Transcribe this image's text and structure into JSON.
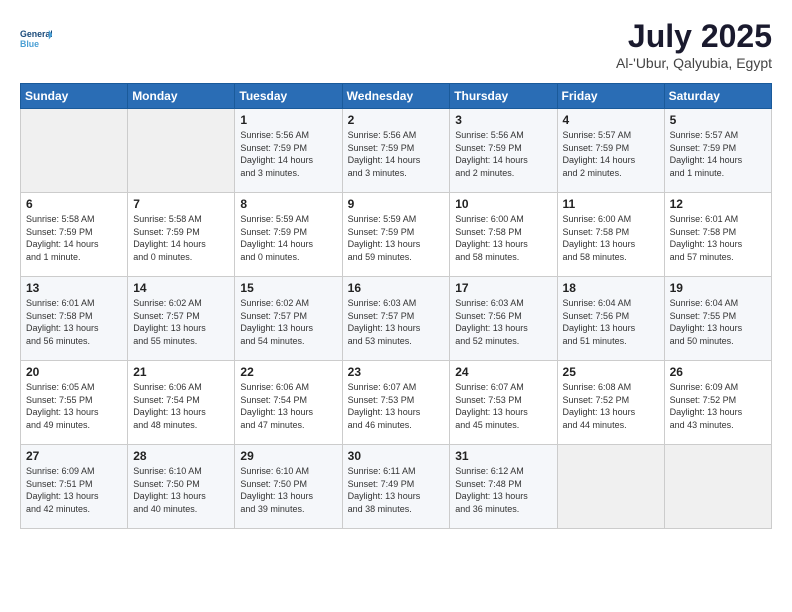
{
  "logo": {
    "line1": "General",
    "line2": "Blue"
  },
  "title": "July 2025",
  "location": "Al-'Ubur, Qalyubia, Egypt",
  "weekdays": [
    "Sunday",
    "Monday",
    "Tuesday",
    "Wednesday",
    "Thursday",
    "Friday",
    "Saturday"
  ],
  "weeks": [
    [
      {
        "day": "",
        "info": ""
      },
      {
        "day": "",
        "info": ""
      },
      {
        "day": "1",
        "info": "Sunrise: 5:56 AM\nSunset: 7:59 PM\nDaylight: 14 hours\nand 3 minutes."
      },
      {
        "day": "2",
        "info": "Sunrise: 5:56 AM\nSunset: 7:59 PM\nDaylight: 14 hours\nand 3 minutes."
      },
      {
        "day": "3",
        "info": "Sunrise: 5:56 AM\nSunset: 7:59 PM\nDaylight: 14 hours\nand 2 minutes."
      },
      {
        "day": "4",
        "info": "Sunrise: 5:57 AM\nSunset: 7:59 PM\nDaylight: 14 hours\nand 2 minutes."
      },
      {
        "day": "5",
        "info": "Sunrise: 5:57 AM\nSunset: 7:59 PM\nDaylight: 14 hours\nand 1 minute."
      }
    ],
    [
      {
        "day": "6",
        "info": "Sunrise: 5:58 AM\nSunset: 7:59 PM\nDaylight: 14 hours\nand 1 minute."
      },
      {
        "day": "7",
        "info": "Sunrise: 5:58 AM\nSunset: 7:59 PM\nDaylight: 14 hours\nand 0 minutes."
      },
      {
        "day": "8",
        "info": "Sunrise: 5:59 AM\nSunset: 7:59 PM\nDaylight: 14 hours\nand 0 minutes."
      },
      {
        "day": "9",
        "info": "Sunrise: 5:59 AM\nSunset: 7:59 PM\nDaylight: 13 hours\nand 59 minutes."
      },
      {
        "day": "10",
        "info": "Sunrise: 6:00 AM\nSunset: 7:58 PM\nDaylight: 13 hours\nand 58 minutes."
      },
      {
        "day": "11",
        "info": "Sunrise: 6:00 AM\nSunset: 7:58 PM\nDaylight: 13 hours\nand 58 minutes."
      },
      {
        "day": "12",
        "info": "Sunrise: 6:01 AM\nSunset: 7:58 PM\nDaylight: 13 hours\nand 57 minutes."
      }
    ],
    [
      {
        "day": "13",
        "info": "Sunrise: 6:01 AM\nSunset: 7:58 PM\nDaylight: 13 hours\nand 56 minutes."
      },
      {
        "day": "14",
        "info": "Sunrise: 6:02 AM\nSunset: 7:57 PM\nDaylight: 13 hours\nand 55 minutes."
      },
      {
        "day": "15",
        "info": "Sunrise: 6:02 AM\nSunset: 7:57 PM\nDaylight: 13 hours\nand 54 minutes."
      },
      {
        "day": "16",
        "info": "Sunrise: 6:03 AM\nSunset: 7:57 PM\nDaylight: 13 hours\nand 53 minutes."
      },
      {
        "day": "17",
        "info": "Sunrise: 6:03 AM\nSunset: 7:56 PM\nDaylight: 13 hours\nand 52 minutes."
      },
      {
        "day": "18",
        "info": "Sunrise: 6:04 AM\nSunset: 7:56 PM\nDaylight: 13 hours\nand 51 minutes."
      },
      {
        "day": "19",
        "info": "Sunrise: 6:04 AM\nSunset: 7:55 PM\nDaylight: 13 hours\nand 50 minutes."
      }
    ],
    [
      {
        "day": "20",
        "info": "Sunrise: 6:05 AM\nSunset: 7:55 PM\nDaylight: 13 hours\nand 49 minutes."
      },
      {
        "day": "21",
        "info": "Sunrise: 6:06 AM\nSunset: 7:54 PM\nDaylight: 13 hours\nand 48 minutes."
      },
      {
        "day": "22",
        "info": "Sunrise: 6:06 AM\nSunset: 7:54 PM\nDaylight: 13 hours\nand 47 minutes."
      },
      {
        "day": "23",
        "info": "Sunrise: 6:07 AM\nSunset: 7:53 PM\nDaylight: 13 hours\nand 46 minutes."
      },
      {
        "day": "24",
        "info": "Sunrise: 6:07 AM\nSunset: 7:53 PM\nDaylight: 13 hours\nand 45 minutes."
      },
      {
        "day": "25",
        "info": "Sunrise: 6:08 AM\nSunset: 7:52 PM\nDaylight: 13 hours\nand 44 minutes."
      },
      {
        "day": "26",
        "info": "Sunrise: 6:09 AM\nSunset: 7:52 PM\nDaylight: 13 hours\nand 43 minutes."
      }
    ],
    [
      {
        "day": "27",
        "info": "Sunrise: 6:09 AM\nSunset: 7:51 PM\nDaylight: 13 hours\nand 42 minutes."
      },
      {
        "day": "28",
        "info": "Sunrise: 6:10 AM\nSunset: 7:50 PM\nDaylight: 13 hours\nand 40 minutes."
      },
      {
        "day": "29",
        "info": "Sunrise: 6:10 AM\nSunset: 7:50 PM\nDaylight: 13 hours\nand 39 minutes."
      },
      {
        "day": "30",
        "info": "Sunrise: 6:11 AM\nSunset: 7:49 PM\nDaylight: 13 hours\nand 38 minutes."
      },
      {
        "day": "31",
        "info": "Sunrise: 6:12 AM\nSunset: 7:48 PM\nDaylight: 13 hours\nand 36 minutes."
      },
      {
        "day": "",
        "info": ""
      },
      {
        "day": "",
        "info": ""
      }
    ]
  ]
}
